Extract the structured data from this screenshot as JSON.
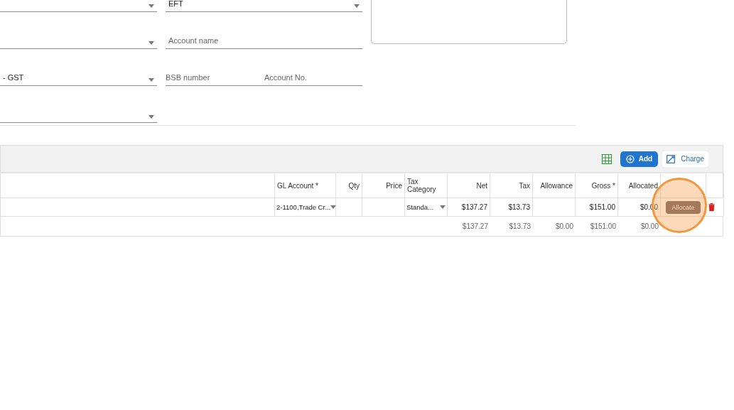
{
  "form": {
    "left_fields": [
      {
        "kind": "dropdown"
      },
      {
        "kind": "dropdown"
      },
      {
        "kind": "dropdown",
        "value": "- GST"
      },
      {
        "kind": "dropdown"
      }
    ],
    "payment_method": {
      "value": "EFT"
    },
    "account_name": {
      "placeholder": "Account name"
    },
    "bsb_number": {
      "placeholder": "BSB number"
    },
    "account_no": {
      "placeholder": "Account No."
    }
  },
  "toolbar": {
    "buttons": [
      {
        "kind": "grid"
      },
      {
        "kind": "primary",
        "label": "Add"
      },
      {
        "kind": "link",
        "label": "Charge"
      }
    ]
  },
  "table": {
    "columns": [
      {
        "label": "GL Account *"
      },
      {
        "label": "Qty"
      },
      {
        "label": "Price"
      },
      {
        "label": "Tax Category"
      },
      {
        "label": "Net"
      },
      {
        "label": "Tax"
      },
      {
        "label": "Allowance"
      },
      {
        "label": "Gross *"
      },
      {
        "label": "Allocated"
      }
    ],
    "rows": [
      {
        "cells": [
          {
            "kind": "select",
            "text": "2-1100,Trade Cr..."
          },
          {
            "kind": "blank"
          },
          {
            "kind": "blank"
          },
          {
            "kind": "select",
            "text": "Standa..."
          },
          {
            "kind": "text",
            "text": "$137.27"
          },
          {
            "kind": "text",
            "text": "$13.73"
          },
          {
            "kind": "blank"
          },
          {
            "kind": "text",
            "text": "$151.00"
          },
          {
            "kind": "text",
            "text": "$0.00"
          }
        ],
        "action": "Allocate"
      }
    ],
    "totals": [
      {
        "kind": "blank"
      },
      {
        "kind": "blank"
      },
      {
        "kind": "blank"
      },
      {
        "kind": "blank"
      },
      {
        "kind": "text",
        "text": "$137.27"
      },
      {
        "kind": "text",
        "text": "$13.73"
      },
      {
        "kind": "text",
        "text": "$0.00"
      },
      {
        "kind": "text",
        "text": "$151.00"
      },
      {
        "kind": "text",
        "text": "$0.00"
      }
    ]
  }
}
